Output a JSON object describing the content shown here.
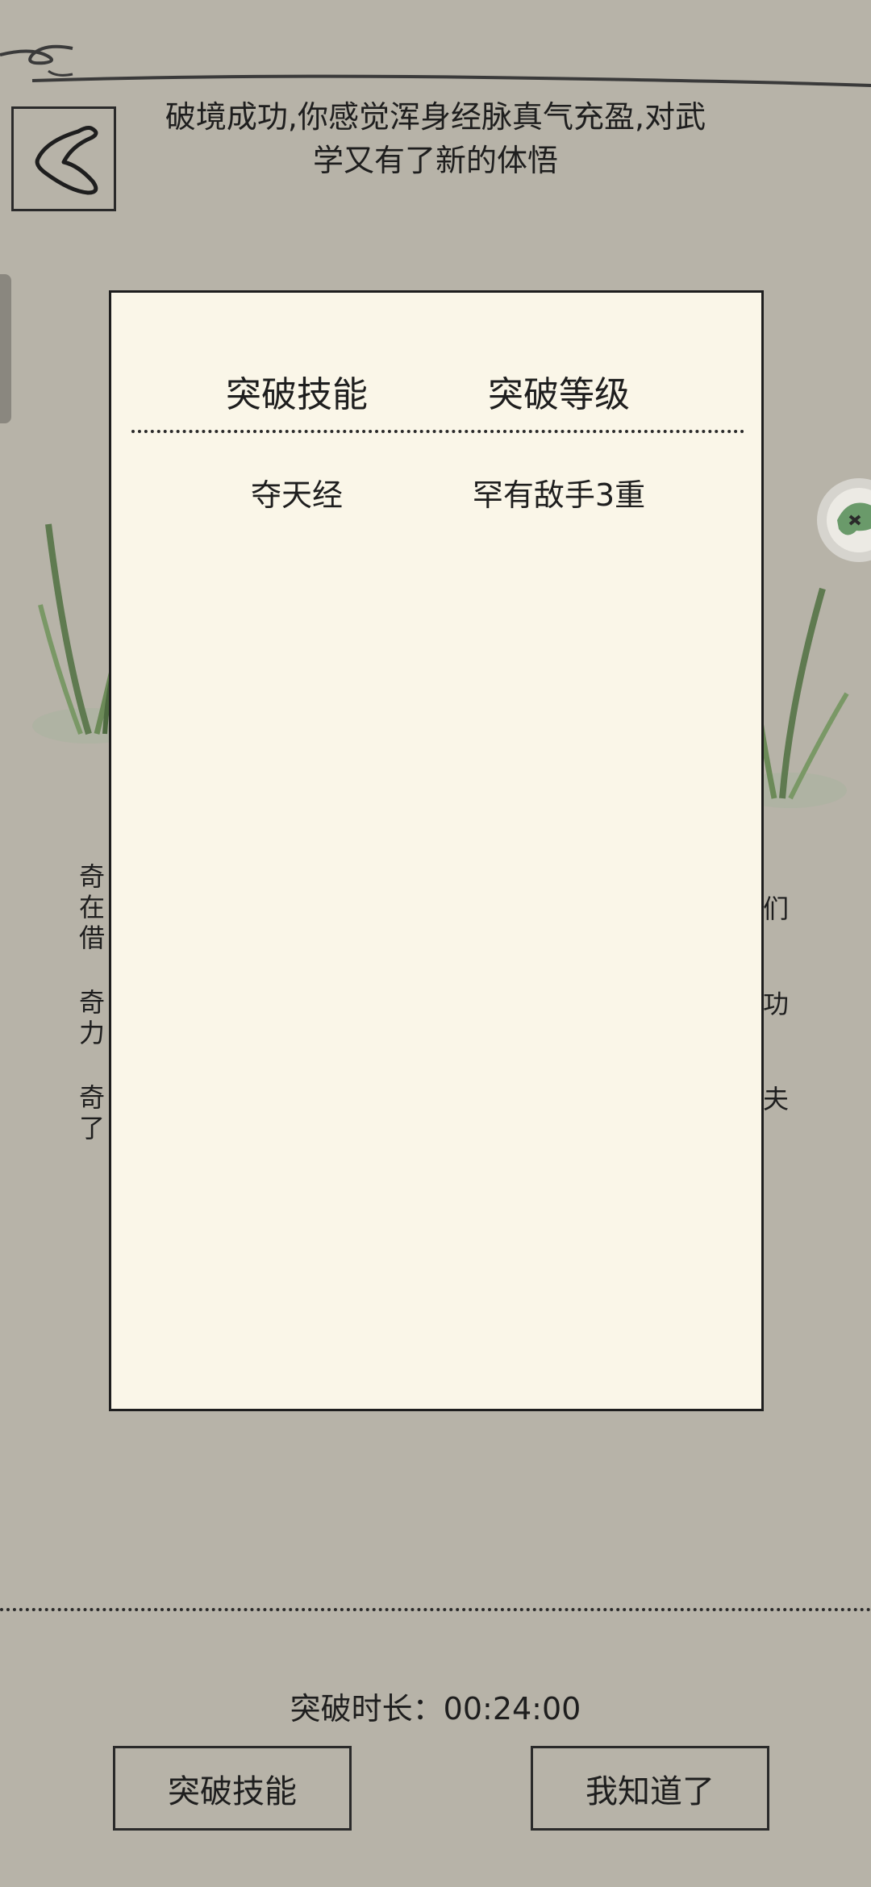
{
  "header": {
    "message_line1": "破境成功,你感觉浑身经脉真气充盈,对武",
    "message_line2": "学又有了新的体悟"
  },
  "background_text": {
    "left_col1": [
      "奇",
      "在",
      "借"
    ],
    "left_col2": [
      "奇",
      "力"
    ],
    "left_col3": [
      "奇",
      "了"
    ],
    "right_fragments": [
      "们",
      "功",
      "夫"
    ]
  },
  "panel": {
    "headers": [
      "突破技能",
      "突破等级"
    ],
    "rows": [
      {
        "skill": "夺天经",
        "level": "罕有敌手3重"
      }
    ]
  },
  "footer": {
    "duration_label": "突破时长：00:24:00",
    "button_skill": "突破技能",
    "button_ok": "我知道了"
  },
  "icons": {
    "back": "back-chevron-icon",
    "float": "float-helper-icon"
  },
  "colors": {
    "background": "#b7b3a8",
    "panel": "#faf6e8",
    "ink": "#1e1e1e"
  }
}
